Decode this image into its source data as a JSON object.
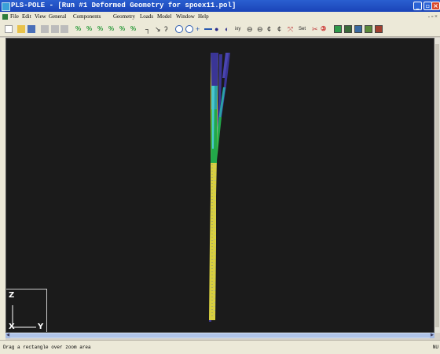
{
  "window": {
    "title": "PLS-POLE - [Run #1 Deformed Geometry for spoex11.pol]",
    "minimize": "_",
    "maximize": "▫",
    "close": "×"
  },
  "menu": {
    "items": [
      "File",
      "Edit",
      "View",
      "General",
      "Components",
      "Geometry",
      "Loads",
      "Model",
      "Window",
      "Help"
    ],
    "mdi_controls": "- ▫ ×"
  },
  "toolbar": {
    "icons": [
      "new-icon",
      "open-icon",
      "save-icon",
      "cut-icon",
      "copy-icon",
      "paste-icon",
      "percent-icon",
      "zoom-in-icon",
      "zoom-out-icon",
      "pan-icon",
      "rotate-icon",
      "color-icon"
    ],
    "set_label": "Set",
    "red_symbol": "③"
  },
  "viewport": {
    "background": "#1b1b1b",
    "axis": {
      "z": "Z",
      "x": "X",
      "y": "Y"
    },
    "colors": {
      "top": "#3a3596",
      "upper": "#2aa0a8",
      "middle": "#22a84a",
      "lower": "#d8d040"
    }
  },
  "status": {
    "text": "Drag a rectangle over zoom area",
    "right": "NU"
  }
}
